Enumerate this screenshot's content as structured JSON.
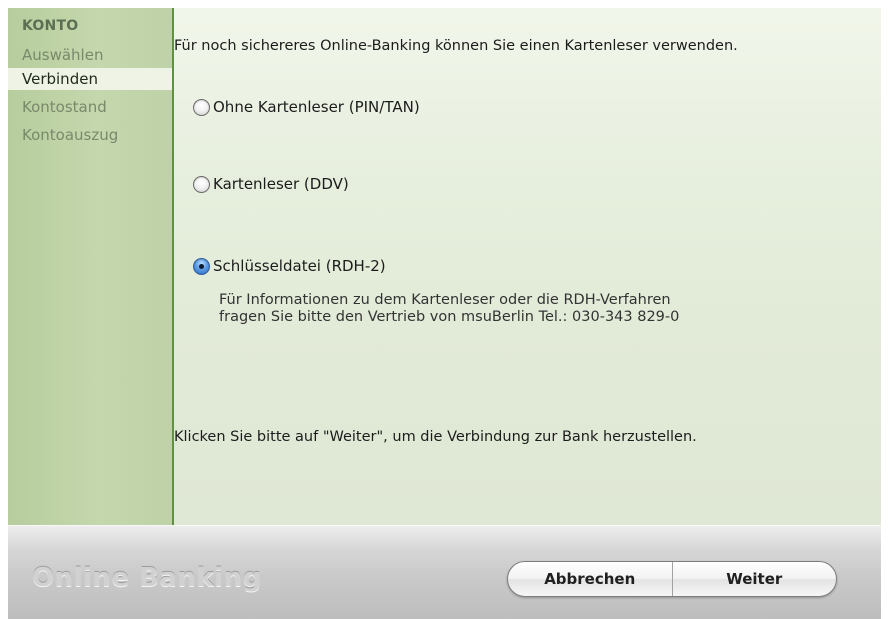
{
  "sidebar": {
    "heading": "KONTO",
    "items": [
      {
        "label": "Auswählen",
        "active": false
      },
      {
        "label": "Verbinden",
        "active": true
      },
      {
        "label": "Kontostand",
        "active": false
      },
      {
        "label": "Kontoauszug",
        "active": false
      }
    ]
  },
  "content": {
    "intro": "Für noch sichereres Online-Banking können Sie einen Kartenleser verwenden.",
    "options": [
      {
        "label": "Ohne Kartenleser (PIN/TAN)",
        "selected": false
      },
      {
        "label": "Kartenleser (DDV)",
        "selected": false
      },
      {
        "label": "Schlüsseldatei (RDH-2)",
        "selected": true
      }
    ],
    "info_line1": "Für Informationen zu dem Kartenleser oder die RDH-Verfahren",
    "info_line2": "fragen Sie bitte den Vertrieb von msuBerlin Tel.: 030-343 829-0",
    "footer": "Klicken Sie bitte auf \"Weiter\", um die Verbindung zur Bank herzustellen."
  },
  "bottom_bar": {
    "brand": "Online Banking",
    "cancel_label": "Abbrechen",
    "next_label": "Weiter"
  },
  "colors": {
    "sidebar_bg": "#bfd2a7",
    "accent_green": "#5f9044",
    "radio_selected": "#2a68c0"
  }
}
